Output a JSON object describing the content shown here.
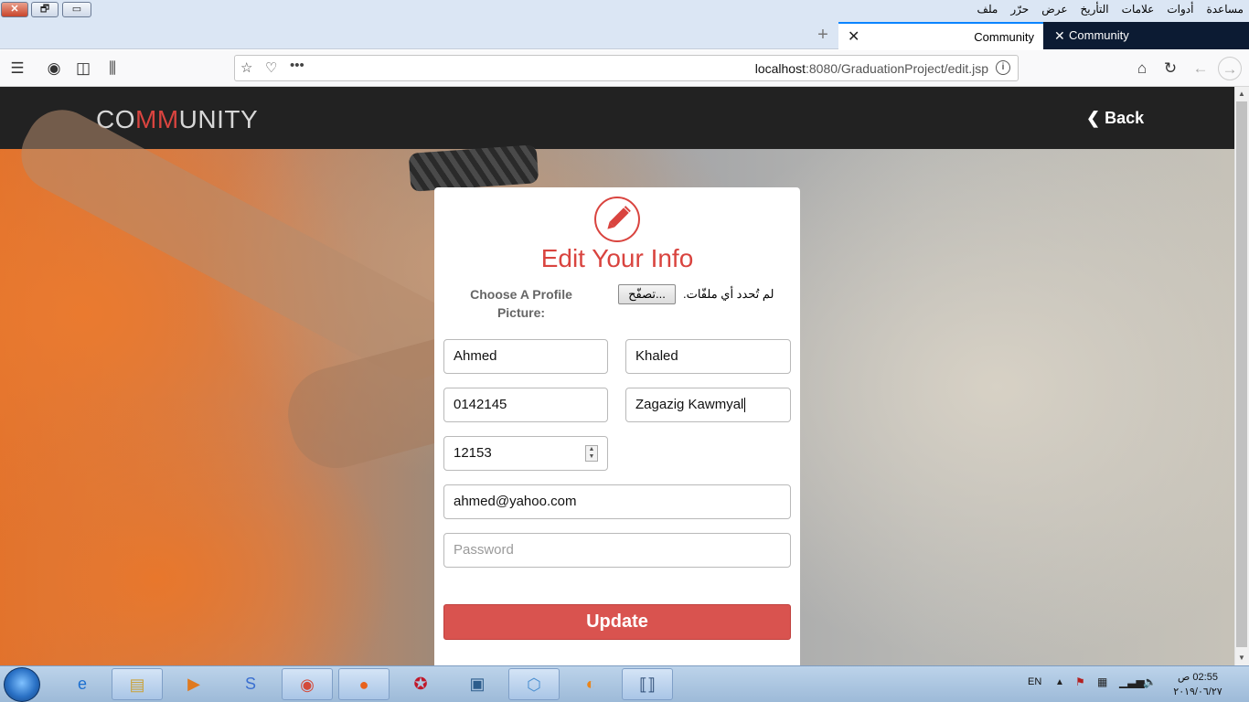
{
  "window": {
    "buttons": {
      "close": "✕",
      "restore": "🗗",
      "minimize": "▭"
    },
    "menu": [
      "ملف",
      "حرّر",
      "عرض",
      "التأريخ",
      "علامات",
      "أدوات",
      "مساعدة"
    ]
  },
  "tabs": [
    {
      "label": "Community",
      "active": true
    },
    {
      "label": "Community",
      "active": false
    }
  ],
  "urlbar": {
    "host": "localhost",
    "path": ":8080/GraduationProject/edit.jsp"
  },
  "site": {
    "brand": {
      "part1": "CO",
      "part2": "MM",
      "part3": "UNITY"
    },
    "back_label": "Back"
  },
  "form": {
    "title": "Edit Your Info",
    "picture_label": "Choose A Profile Picture:",
    "browse_label": "...تصفّح",
    "no_file_text": "لم تُحدد أي ملفّات.",
    "first_name": "Ahmed",
    "last_name": "Khaled",
    "phone": "0142145",
    "address": "Zagazig Kawmyal",
    "code": "12153",
    "email": "ahmed@yahoo.com",
    "password_placeholder": "Password",
    "submit_label": "Update"
  },
  "taskbar": {
    "language": "EN",
    "time": "02:55 ص",
    "date": "٢٠١٩/٠٦/٢٧"
  },
  "colors": {
    "accent": "#d9443f",
    "button": "#d9534f",
    "header": "#222222"
  }
}
